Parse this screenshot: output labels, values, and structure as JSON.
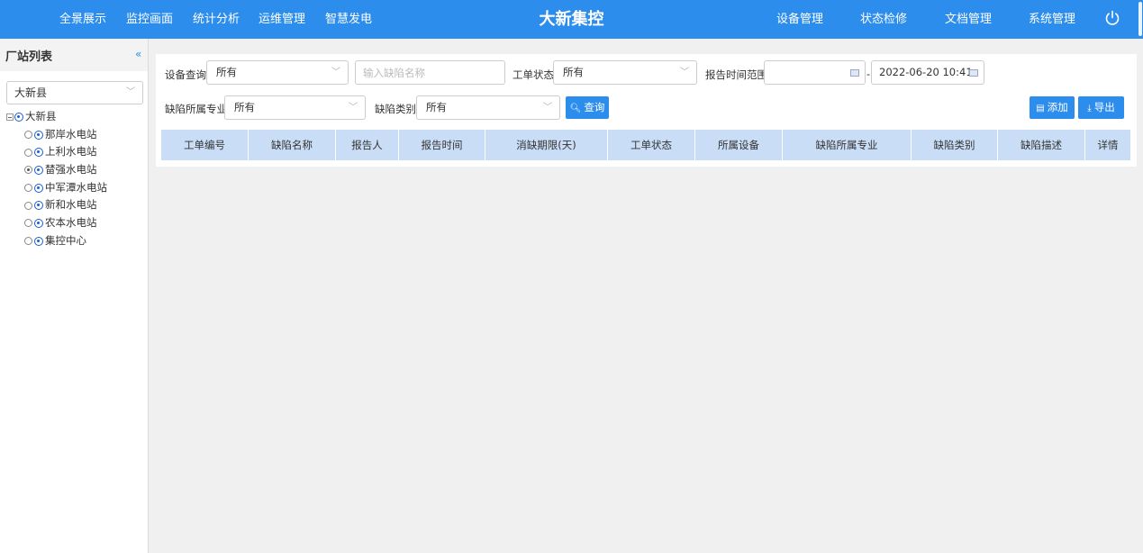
{
  "nav": {
    "left_items": [
      "全景展示",
      "监控画面",
      "统计分析",
      "运维管理",
      "智慧发电"
    ],
    "brand": "大新集控",
    "right_items": [
      "设备管理",
      "状态检修",
      "文档管理",
      "系统管理"
    ],
    "power_icon": "power-icon",
    "bg_color": "#2c8ded"
  },
  "sidebar": {
    "title": "厂站列表",
    "collapse_glyph": "«",
    "county_select": "大新县",
    "tree": {
      "root": "大新县",
      "children": [
        {
          "label": "那岸水电站",
          "checked": false
        },
        {
          "label": "上利水电站",
          "checked": false
        },
        {
          "label": "榃强水电站",
          "checked": true
        },
        {
          "label": "中军潭水电站",
          "checked": false
        },
        {
          "label": "新和水电站",
          "checked": false
        },
        {
          "label": "农本水电站",
          "checked": false
        },
        {
          "label": "集控中心",
          "checked": false
        }
      ]
    }
  },
  "filters": {
    "device_label": "设备查询:",
    "device_value": "所有",
    "defect_name_placeholder": "输入缺陷名称",
    "status_label": "工单状态:",
    "status_value": "所有",
    "time_label": "报告时间范围:",
    "time_start": "",
    "time_separator": "-",
    "time_end": "2022-06-20 10:41",
    "specialty_label": "缺陷所属专业:",
    "specialty_value": "所有",
    "category_label": "缺陷类别:",
    "category_value": "所有",
    "query_button": "查询",
    "add_button": "添加",
    "export_button": "导出"
  },
  "table": {
    "columns": [
      "工单编号",
      "缺陷名称",
      "报告人",
      "报告时间",
      "消缺期限(天)",
      "工单状态",
      "所属设备",
      "缺陷所属专业",
      "缺陷类别",
      "缺陷描述",
      "详情"
    ],
    "rows": [],
    "header_color": "#c9def6"
  }
}
